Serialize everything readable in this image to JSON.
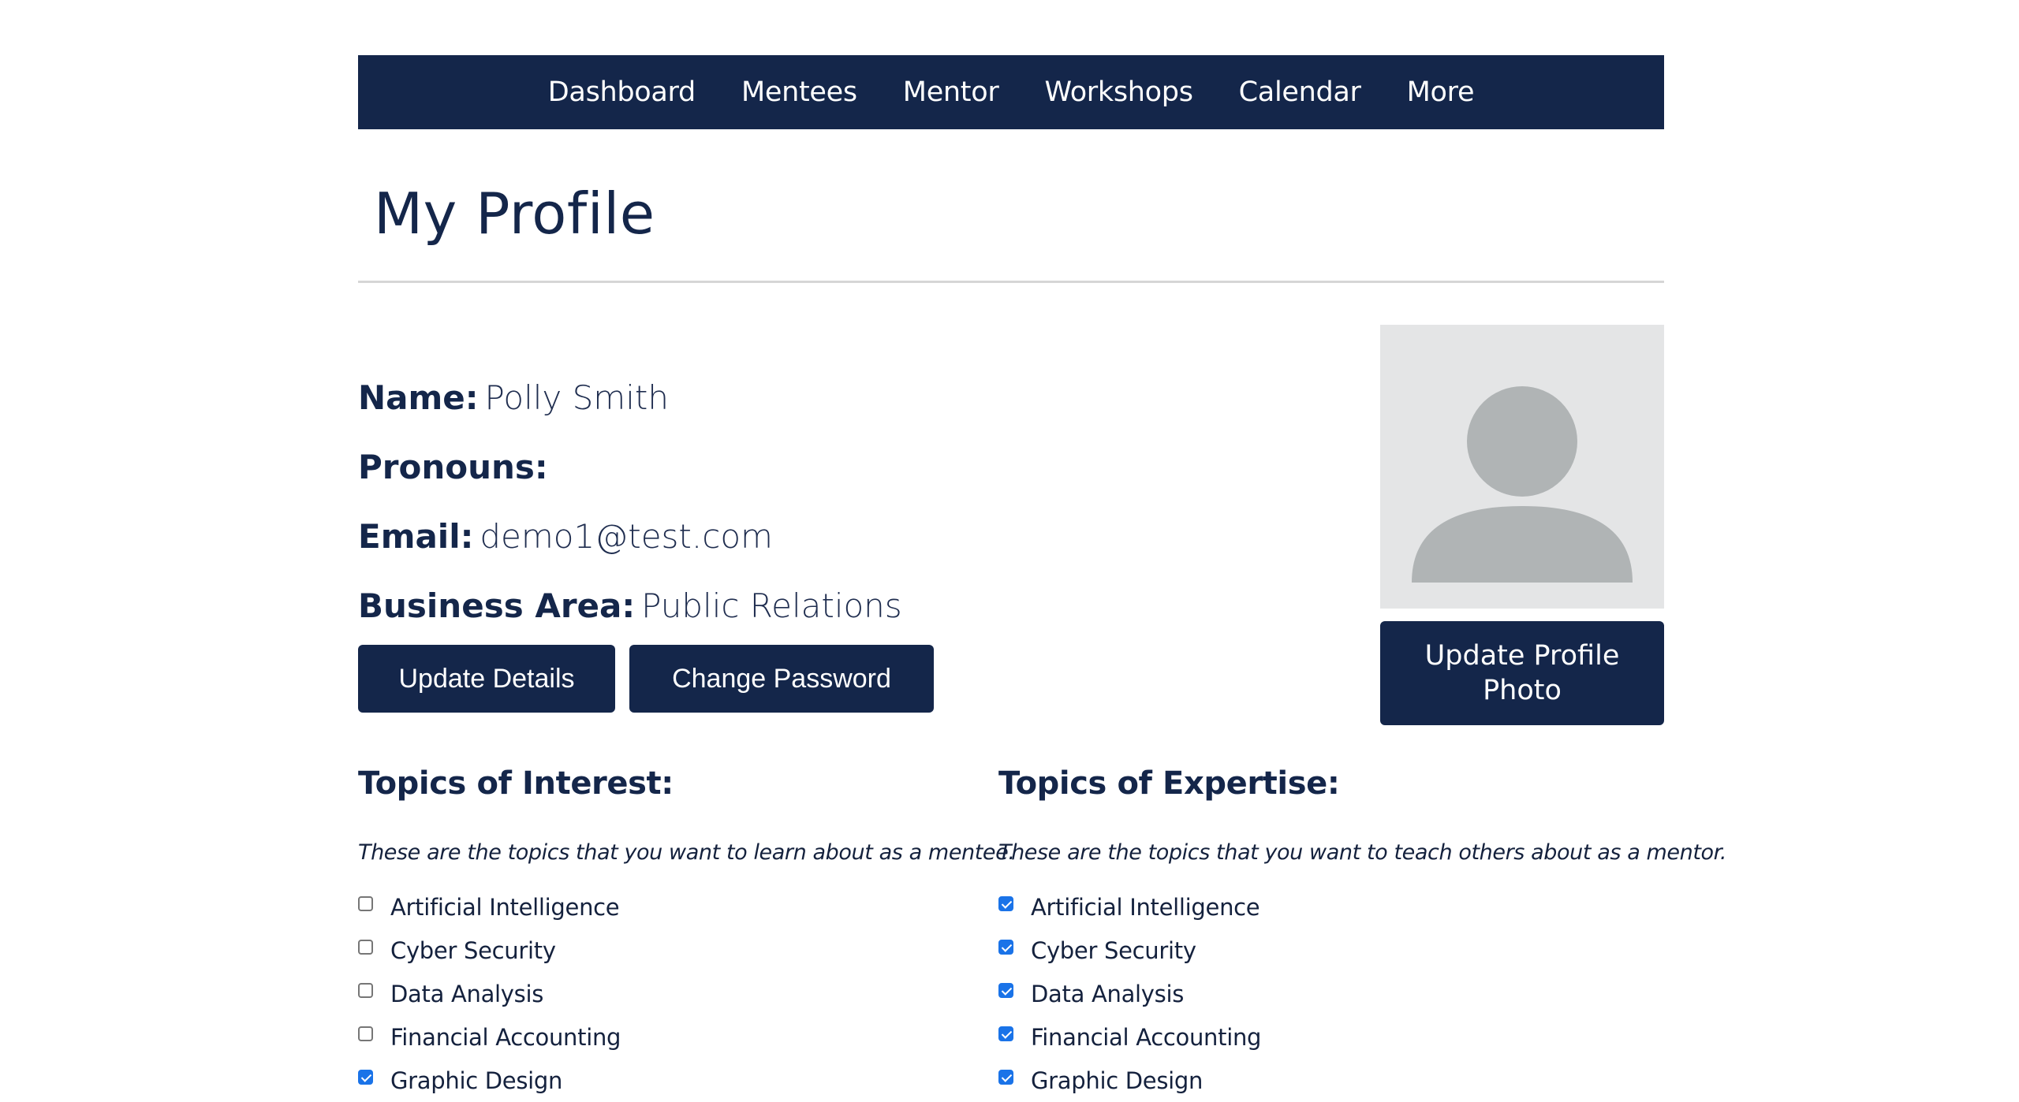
{
  "nav": {
    "items": [
      "Dashboard",
      "Mentees",
      "Mentor",
      "Workshops",
      "Calendar",
      "More"
    ]
  },
  "page": {
    "title": "My Profile"
  },
  "profile": {
    "name_label": "Name:",
    "name_value": "Polly Smith",
    "pronouns_label": "Pronouns:",
    "pronouns_value": "",
    "email_label": "Email:",
    "email_value": "demo1@test.com",
    "business_area_label": "Business Area:",
    "business_area_value": "Public Relations",
    "avatar_icon": "user-placeholder-icon"
  },
  "buttons": {
    "update_details": "Update Details",
    "change_password": "Change Password",
    "update_photo": "Update Profile Photo"
  },
  "interest": {
    "heading": "Topics of Interest:",
    "description": "These are the topics that you want to learn about as a mentee.",
    "topics": [
      {
        "label": "Artificial Intelligence",
        "checked": false
      },
      {
        "label": "Cyber Security",
        "checked": false
      },
      {
        "label": "Data Analysis",
        "checked": false
      },
      {
        "label": "Financial Accounting",
        "checked": false
      },
      {
        "label": "Graphic Design",
        "checked": true
      }
    ]
  },
  "expertise": {
    "heading": "Topics of Expertise:",
    "description": "These are the topics that you want to teach others about as a mentor.",
    "topics": [
      {
        "label": "Artificial Intelligence",
        "checked": true
      },
      {
        "label": "Cyber Security",
        "checked": true
      },
      {
        "label": "Data Analysis",
        "checked": true
      },
      {
        "label": "Financial Accounting",
        "checked": true
      },
      {
        "label": "Graphic Design",
        "checked": true
      }
    ]
  },
  "colors": {
    "navy": "#14264a",
    "checkbox_blue": "#1a73e8",
    "avatar_bg": "#e4e5e6",
    "avatar_fg": "#b0b4b5",
    "divider": "#d6d6d6"
  }
}
